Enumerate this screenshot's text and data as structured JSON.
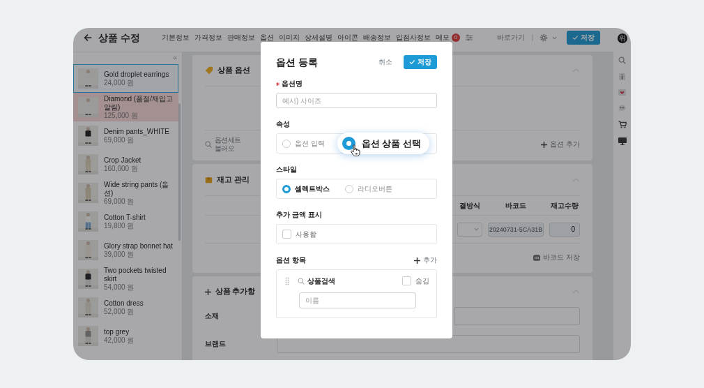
{
  "header": {
    "title": "상품 수정",
    "tabs": [
      {
        "label": "기본정보"
      },
      {
        "label": "가격정보"
      },
      {
        "label": "판매정보"
      },
      {
        "label": "옵션"
      },
      {
        "label": "이미지"
      },
      {
        "label": "상세설명"
      },
      {
        "label": "아이콘"
      },
      {
        "label": "배송정보"
      },
      {
        "label": "입점사정보"
      },
      {
        "label": "메모",
        "badge": "0"
      }
    ],
    "shortcut": "바로가기",
    "save": "저장"
  },
  "rail": {
    "avatar": "위"
  },
  "sidebar": {
    "collapse": "«",
    "items": [
      {
        "name": "Gold droplet earrings",
        "price": "24,000 원",
        "selected": true,
        "highlighted": false
      },
      {
        "name": "Diamond (품절/재입고알림)",
        "price": "125,000 원",
        "selected": false,
        "highlighted": true
      },
      {
        "name": "Denim pants_WHITE",
        "price": "69,000 원",
        "selected": false,
        "highlighted": false
      },
      {
        "name": "Crop Jacket",
        "price": "160,000 원",
        "selected": false,
        "highlighted": false
      },
      {
        "name": "Wide string pants (옵션)",
        "price": "69,000 원",
        "selected": false,
        "highlighted": false
      },
      {
        "name": "Cotton T-shirt",
        "price": "19,800 원",
        "selected": false,
        "highlighted": false
      },
      {
        "name": "Glory strap bonnet hat",
        "price": "39,000 원",
        "selected": false,
        "highlighted": false
      },
      {
        "name": "Two pockets twisted skirt",
        "price": "54,000 원",
        "selected": false,
        "highlighted": false
      },
      {
        "name": "Cotton dress",
        "price": "52,000 원",
        "selected": false,
        "highlighted": false
      },
      {
        "name": "top grey",
        "price": "42,000 원",
        "selected": false,
        "highlighted": false
      }
    ]
  },
  "sections": [
    {
      "kind": "options",
      "title": "상품 옵션",
      "load": "옵션세트 불러오",
      "add": "옵션 추가"
    },
    {
      "kind": "stock",
      "title": "재고 관리",
      "columns": [
        "결방식",
        "바코드",
        "재고수량"
      ],
      "row": {
        "barcode": "20240731-5CA31B",
        "quantity": "0"
      },
      "save_barcode": "바코드 저장"
    },
    {
      "kind": "extra",
      "title": "상품 추가항",
      "fields": [
        "소재",
        "브랜드"
      ]
    }
  ],
  "modal": {
    "title": "옵션 등록",
    "cancel": "취소",
    "save": "저장",
    "name_field": {
      "label": "옵션명",
      "required": true,
      "placeholder": "예시) 사이즈"
    },
    "attribute": {
      "label": "속성",
      "options": [
        {
          "label": "옵션 입력",
          "selected": false
        },
        {
          "label": "옵션 상품 선택",
          "selected": true
        }
      ]
    },
    "style": {
      "label": "스타일",
      "options": [
        {
          "label": "셀렉트박스",
          "selected": true
        },
        {
          "label": "라디오버튼",
          "selected": false
        }
      ]
    },
    "extra_price": {
      "label": "추가 금액 표시",
      "checkbox": {
        "label": "사용함",
        "checked": false
      }
    },
    "items": {
      "label": "옵션 항목",
      "add": "추가",
      "rows": [
        {
          "search": "상품검색",
          "hide": {
            "label": "숨김",
            "checked": false
          },
          "placeholder": "이름"
        }
      ]
    }
  }
}
